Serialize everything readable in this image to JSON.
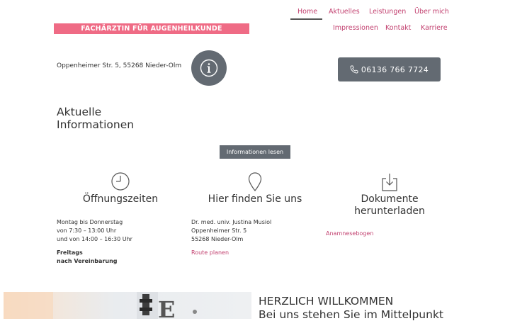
{
  "nav": {
    "row1": [
      {
        "label": "Home",
        "active": true
      },
      {
        "label": "Aktuelles"
      },
      {
        "label": "Leistungen"
      },
      {
        "label": "Über mich"
      }
    ],
    "row2": [
      {
        "label": "Impressionen"
      },
      {
        "label": "Kontakt"
      },
      {
        "label": "Karriere"
      }
    ]
  },
  "banner": {
    "text": "FACHÄRZTIN FÜR AUGENHEILKUNDE"
  },
  "header": {
    "address": "Oppenheimer Str. 5, 55268 Nieder-Olm",
    "info_icon": "info-icon",
    "phone_label": "06136 766 7724",
    "phone_icon": "phone-icon"
  },
  "news": {
    "heading_line1": "Aktuelle",
    "heading_line2": "Informationen",
    "button": "Informationen lesen"
  },
  "hours": {
    "icon": "clock-icon",
    "title": "Öffnungszeiten",
    "line1": "Montag bis Donnerstag",
    "line2": "von 7:30 – 13:00 Uhr",
    "line3": "und von 14:00 – 16:30 Uhr",
    "bold1": "Freitags",
    "bold2": "nach Vereinbarung"
  },
  "location": {
    "icon": "map-pin-icon",
    "title": "Hier finden Sie uns",
    "line1": "Dr. med. univ. Justina Musiol",
    "line2": "Oppenheimer Str. 5",
    "line3": "55268 Nieder-Olm",
    "link": "Route planen"
  },
  "documents": {
    "icon": "download-icon",
    "title_line1": "Dokumente",
    "title_line2": "herunterladen",
    "link": "Anamnesebogen"
  },
  "welcome": {
    "line1": "HERZLICH WILLKOMMEN",
    "line2": "Bei uns stehen Sie im Mittelpunkt"
  },
  "colors": {
    "accent": "#c2406f",
    "banner": "#ef6b85",
    "button": "#636a72"
  }
}
